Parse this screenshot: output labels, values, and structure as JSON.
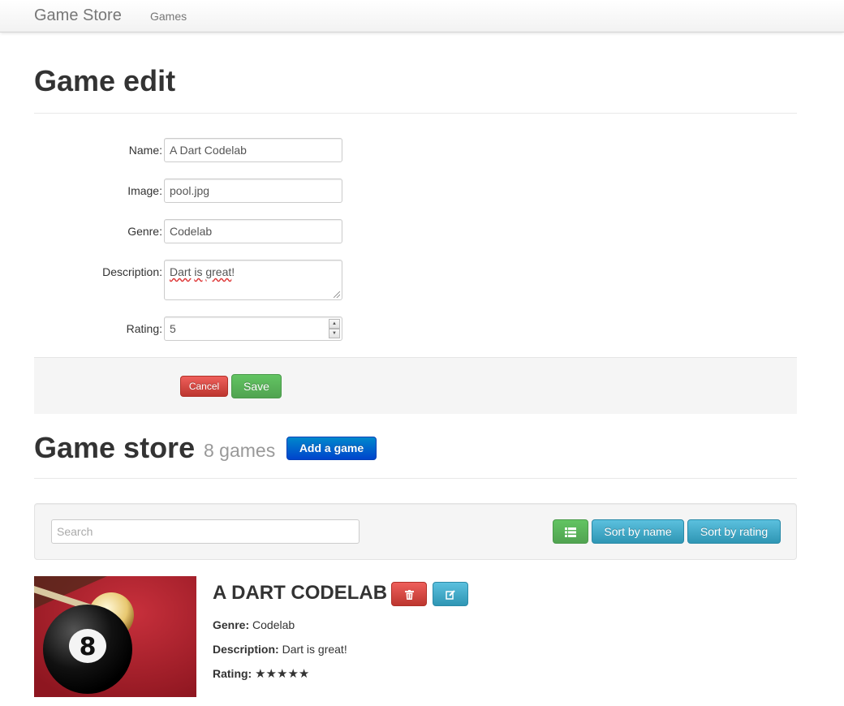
{
  "navbar": {
    "brand": "Game Store",
    "links": [
      "Games"
    ]
  },
  "edit": {
    "title": "Game edit",
    "fields": {
      "name": {
        "label": "Name:",
        "value": "A Dart Codelab"
      },
      "image": {
        "label": "Image:",
        "value": "pool.jpg"
      },
      "genre": {
        "label": "Genre:",
        "value": "Codelab"
      },
      "description": {
        "label": "Description:",
        "value_word1": "Dart",
        "value_word2": "is",
        "value_word3": "great",
        "value_end": "!"
      },
      "rating": {
        "label": "Rating:",
        "value": "5"
      }
    },
    "cancel_label": "Cancel",
    "save_label": "Save"
  },
  "store": {
    "title": "Game store",
    "count": "8 games",
    "add_label": "Add a game",
    "search_placeholder": "Search",
    "list_view_icon": "list-icon",
    "sort_name_label": "Sort by name",
    "sort_rating_label": "Sort by rating"
  },
  "game": {
    "title": "A Dart Codelab",
    "genre_label": "Genre:",
    "genre": "Codelab",
    "description_label": "Description:",
    "description": "Dart is great!",
    "rating_label": "Rating:",
    "rating_stars": "★★★★★",
    "rating_value": 5,
    "delete_icon": "trash-icon",
    "edit_icon": "edit-icon"
  },
  "colors": {
    "danger": "#bd362f",
    "success": "#51a351",
    "primary": "#0044cc",
    "info": "#2f96b4"
  }
}
